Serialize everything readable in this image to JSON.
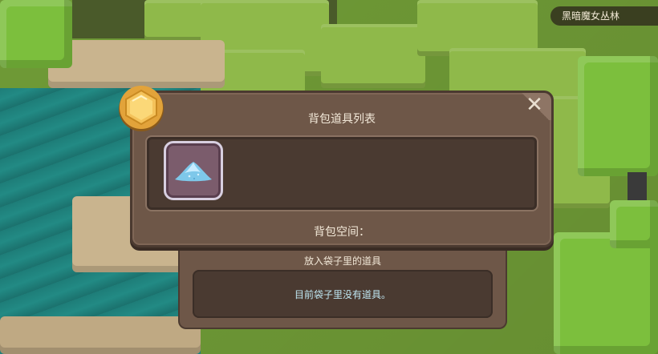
{
  "location": {
    "name": "黑暗魔女丛林"
  },
  "backpack_panel": {
    "title": "背包道具列表",
    "close_icon": "close-icon",
    "slots": [
      {
        "item_icon": "powder-pile-icon",
        "item_color": "#7ec8ea"
      }
    ],
    "space_label": "背包空间："
  },
  "bag_panel": {
    "title": "放入袋子里的道具",
    "empty_message": "目前袋子里没有道具。"
  },
  "colors": {
    "panel": "#6e5748",
    "panel_dark": "#4a3a31",
    "text": "#f2e8d8",
    "empty_text": "#bfe7f2",
    "badge": "#e8a93a"
  }
}
